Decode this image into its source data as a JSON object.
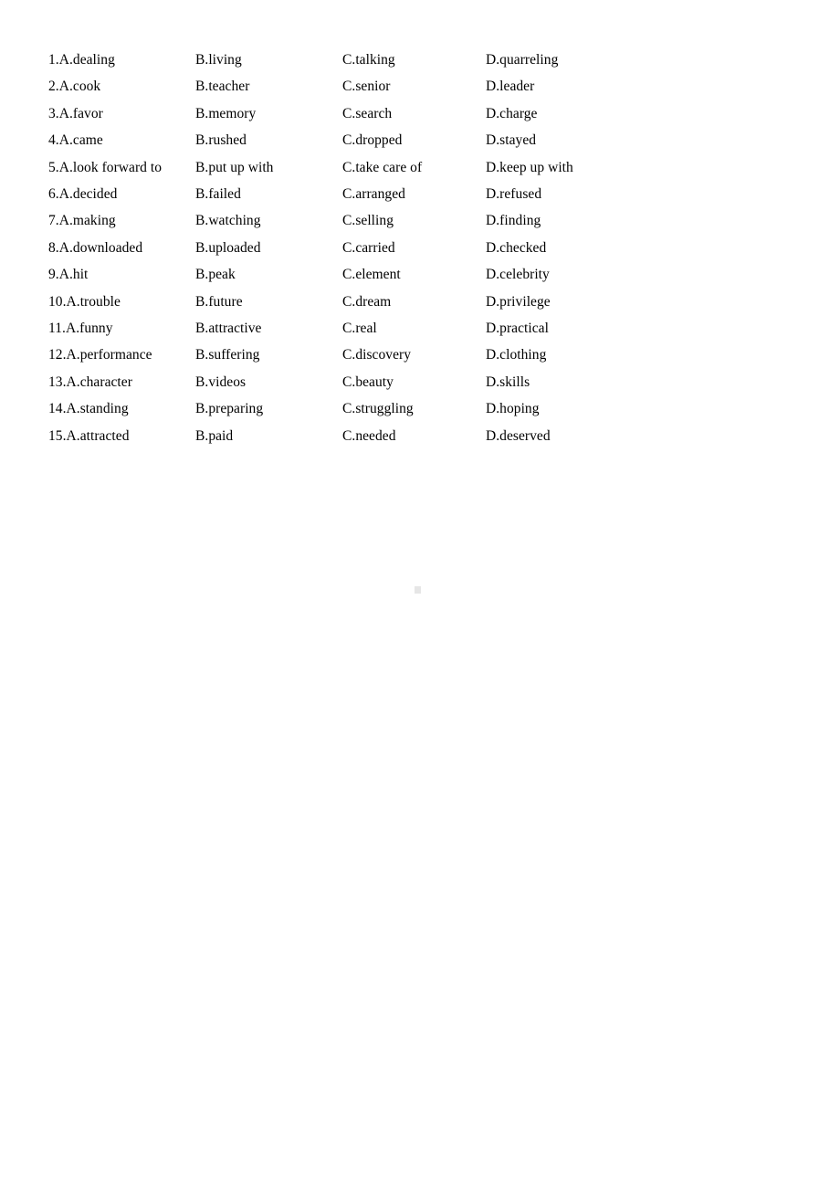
{
  "document": {
    "page_background": "#ffffff",
    "text_color": "#000000",
    "type": "multiple-choice-options-list",
    "total_questions": 15,
    "columns": [
      "A",
      "B",
      "C",
      "D"
    ]
  },
  "artifact": {
    "name": "scan-artifact",
    "color": "#e6e6e6"
  },
  "rows": [
    {
      "number": "1",
      "a": "1.A.dealing",
      "b": "B.living",
      "c": "C.talking",
      "d": "D.quarreling"
    },
    {
      "number": "2",
      "a": "2.A.cook",
      "b": "B.teacher",
      "c": "C.senior",
      "d": "D.leader"
    },
    {
      "number": "3",
      "a": "3.A.favor",
      "b": "B.memory",
      "c": "C.search",
      "d": "D.charge"
    },
    {
      "number": "4",
      "a": "4.A.came",
      "b": "B.rushed",
      "c": "C.dropped",
      "d": "D.stayed"
    },
    {
      "number": "5",
      "a": "5.A.look forward to",
      "b": "B.put up with",
      "c": "C.take care of",
      "d": "D.keep up with"
    },
    {
      "number": "6",
      "a": "6.A.decided",
      "b": "B.failed",
      "c": "C.arranged",
      "d": "D.refused"
    },
    {
      "number": "7",
      "a": "7.A.making",
      "b": "B.watching",
      "c": "C.selling",
      "d": "D.finding"
    },
    {
      "number": "8",
      "a": "8.A.downloaded",
      "b": "B.uploaded",
      "c": "C.carried",
      "d": "D.checked"
    },
    {
      "number": "9",
      "a": "9.A.hit",
      "b": "B.peak",
      "c": "C.element",
      "d": "D.celebrity"
    },
    {
      "number": "10",
      "a": "10.A.trouble",
      "b": "B.future",
      "c": "C.dream",
      "d": "D.privilege"
    },
    {
      "number": "11",
      "a": "11.A.funny",
      "b": "B.attractive",
      "c": "C.real",
      "d": "D.practical"
    },
    {
      "number": "12",
      "a": "12.A.performance",
      "b": "B.suffering",
      "c": "C.discovery",
      "d": "D.clothing"
    },
    {
      "number": "13",
      "a": "13.A.character",
      "b": "B.videos",
      "c": "C.beauty",
      "d": "D.skills"
    },
    {
      "number": "14",
      "a": "14.A.standing",
      "b": "B.preparing",
      "c": "C.struggling",
      "d": "D.hoping"
    },
    {
      "number": "15",
      "a": "15.A.attracted",
      "b": "B.paid",
      "c": "C.needed",
      "d": "D.deserved"
    }
  ]
}
